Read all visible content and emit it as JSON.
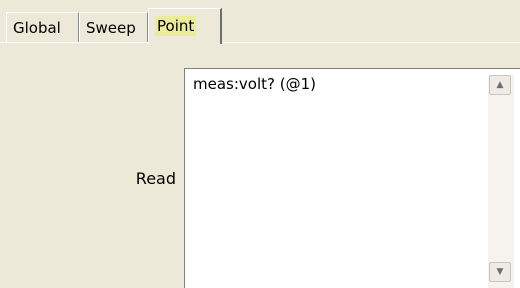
{
  "tabs": [
    {
      "label": "Global"
    },
    {
      "label": "Sweep"
    },
    {
      "label": "Point",
      "active": true
    }
  ],
  "point_panel": {
    "read_label": "Read",
    "read_text": "meas:volt? (@1)"
  },
  "icons": {
    "scroll_up": "scroll-up-arrow-icon",
    "scroll_down": "scroll-down-arrow-icon"
  },
  "colors": {
    "active_tab_highlight": "#ebeb9a",
    "panel_background": "#ece9d8"
  }
}
